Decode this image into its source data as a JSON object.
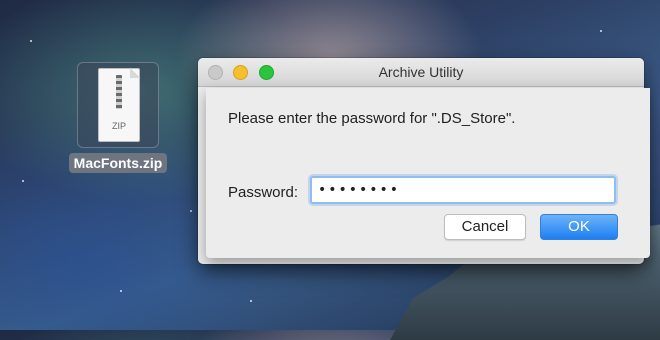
{
  "desktop": {
    "file_icon_name": "zip-file-icon",
    "file_type_label": "ZIP",
    "file_name": "MacFonts.zip"
  },
  "dialog": {
    "title": "Archive Utility",
    "prompt": "Please enter the password for \".DS_Store\".",
    "password_label": "Password:",
    "password_value": "••••••••",
    "cancel_label": "Cancel",
    "ok_label": "OK"
  },
  "colors": {
    "accent_blue": "#1d7ff2",
    "close_light": "#c9c9c9",
    "minimize_light": "#f5bf2e",
    "zoom_light": "#2cc43f"
  }
}
